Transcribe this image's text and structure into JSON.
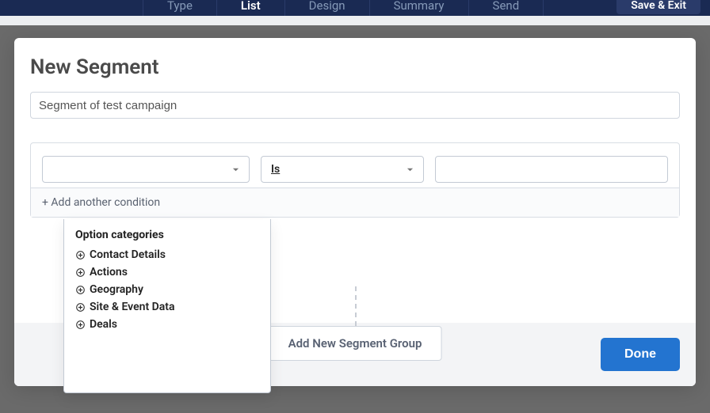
{
  "nav": {
    "tabs": [
      "Type",
      "List",
      "Design",
      "Summary",
      "Send"
    ],
    "active_index": 1,
    "save_exit": "Save & Exit"
  },
  "modal": {
    "title": "New Segment",
    "segment_name": "Segment of test campaign",
    "field_value": "",
    "operator": "Is",
    "value": "",
    "add_condition": "+ Add another condition",
    "add_group": "Add New Segment Group",
    "done": "Done"
  },
  "dropdown": {
    "header": "Option categories",
    "options": [
      "Contact Details",
      "Actions",
      "Geography",
      "Site & Event Data",
      "Deals"
    ]
  }
}
